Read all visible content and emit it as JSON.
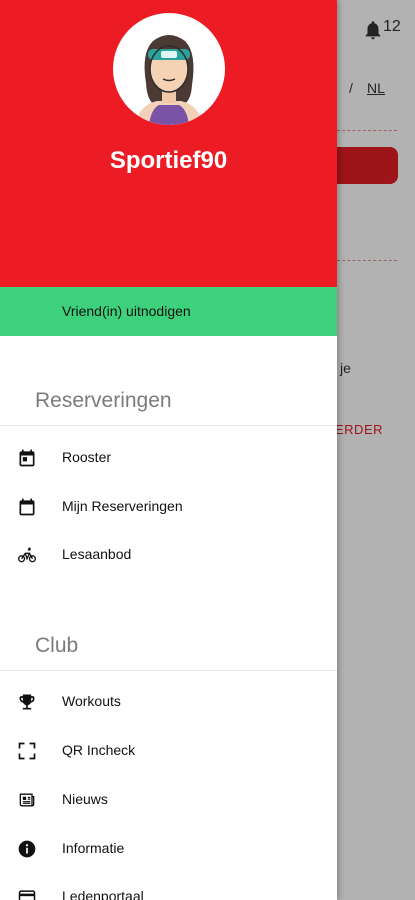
{
  "background": {
    "notification_count": "12",
    "lang_separator": "/",
    "lang_active": "NL",
    "text_partial_1": "je",
    "text_partial_2": "ERDER"
  },
  "drawer": {
    "username": "Sportief90",
    "invite_label": "Vriend(in) uitnodigen",
    "sections": [
      {
        "title": "Reserveringen",
        "items": [
          {
            "label": "Rooster",
            "icon": "calendar-icon"
          },
          {
            "label": "Mijn Reserveringen",
            "icon": "calendar-icon"
          },
          {
            "label": "Lesaanbod",
            "icon": "bicycle-icon"
          }
        ]
      },
      {
        "title": "Club",
        "items": [
          {
            "label": "Workouts",
            "icon": "trophy-icon"
          },
          {
            "label": "QR Incheck",
            "icon": "qr-scan-icon"
          },
          {
            "label": "Nieuws",
            "icon": "newspaper-icon"
          },
          {
            "label": "Informatie",
            "icon": "info-icon"
          },
          {
            "label": "Ledenportaal",
            "icon": "card-icon"
          }
        ]
      }
    ]
  },
  "colors": {
    "brand_red": "#ed1c24",
    "invite_green": "#3ed17b"
  }
}
